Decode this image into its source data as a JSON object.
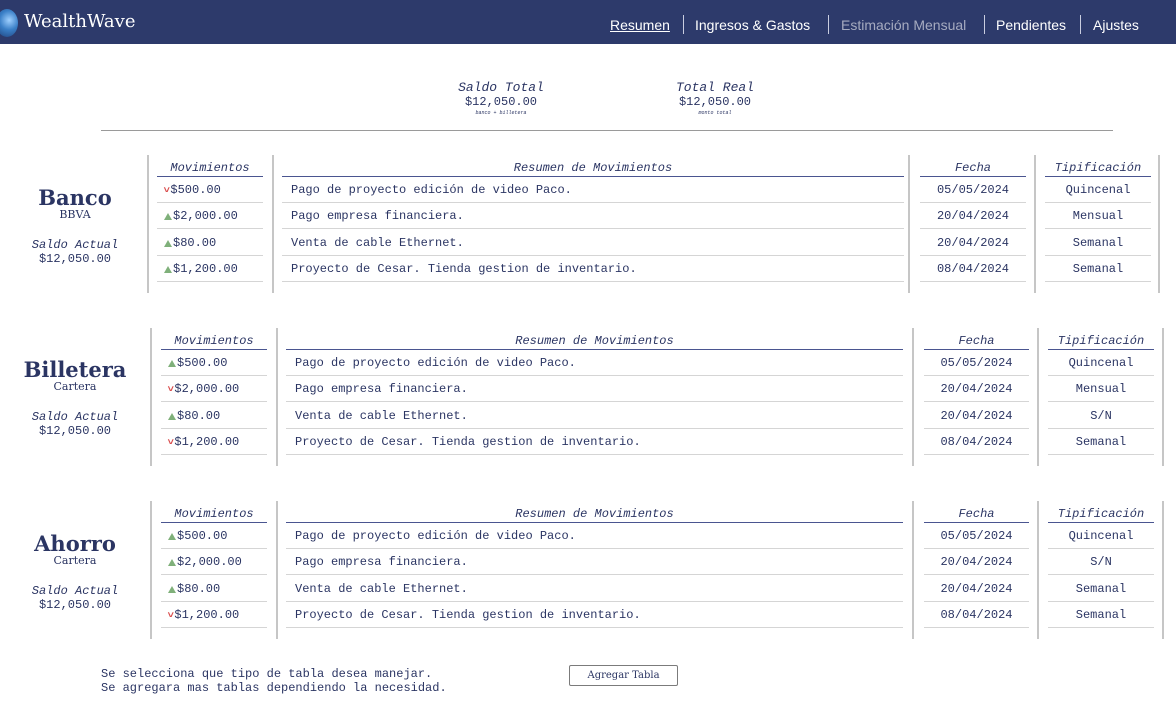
{
  "app": {
    "brand": "WealthWave"
  },
  "nav": {
    "items": [
      {
        "label": "Resumen",
        "state": "active"
      },
      {
        "label": "Ingresos & Gastos",
        "state": "normal"
      },
      {
        "label": "Estimación Mensual",
        "state": "muted"
      },
      {
        "label": "Pendientes",
        "state": "normal"
      },
      {
        "label": "Ajustes",
        "state": "normal"
      }
    ]
  },
  "summary": {
    "saldo_total": {
      "title": "Saldo Total",
      "value": "$12,050.00",
      "note": "banco + billetera"
    },
    "total_real": {
      "title": "Total Real",
      "value": "$12,050.00",
      "note": "monto total"
    }
  },
  "table_headers": {
    "movimientos": "Movimientos",
    "resumen": "Resumen de Movimientos",
    "fecha": "Fecha",
    "tipificacion": "Tipificación"
  },
  "accounts": [
    {
      "name": "Banco",
      "subtitle": "BBVA",
      "saldo_label": "Saldo Actual",
      "saldo_value": "$12,050.00",
      "rows": [
        {
          "dir": "down",
          "amount": "$500.00",
          "desc": "Pago de proyecto edición de video Paco.",
          "date": "05/05/2024",
          "type": "Quincenal"
        },
        {
          "dir": "up",
          "amount": "$2,000.00",
          "desc": "Pago empresa financiera.",
          "date": "20/04/2024",
          "type": "Mensual"
        },
        {
          "dir": "up",
          "amount": "$80.00",
          "desc": "Venta de cable Ethernet.",
          "date": "20/04/2024",
          "type": "Semanal"
        },
        {
          "dir": "up",
          "amount": "$1,200.00",
          "desc": "Proyecto de Cesar. Tienda gestion de inventario.",
          "date": "08/04/2024",
          "type": "Semanal"
        }
      ]
    },
    {
      "name": "Billetera",
      "subtitle": "Cartera",
      "saldo_label": "Saldo Actual",
      "saldo_value": "$12,050.00",
      "rows": [
        {
          "dir": "up",
          "amount": "$500.00",
          "desc": "Pago de proyecto edición de video Paco.",
          "date": "05/05/2024",
          "type": "Quincenal"
        },
        {
          "dir": "down",
          "amount": "$2,000.00",
          "desc": "Pago empresa financiera.",
          "date": "20/04/2024",
          "type": "Mensual"
        },
        {
          "dir": "up",
          "amount": "$80.00",
          "desc": "Venta de cable Ethernet.",
          "date": "20/04/2024",
          "type": "S/N"
        },
        {
          "dir": "down",
          "amount": "$1,200.00",
          "desc": "Proyecto de Cesar. Tienda gestion de inventario.",
          "date": "08/04/2024",
          "type": "Semanal"
        }
      ]
    },
    {
      "name": "Ahorro",
      "subtitle": "Cartera",
      "saldo_label": "Saldo Actual",
      "saldo_value": "$12,050.00",
      "rows": [
        {
          "dir": "up",
          "amount": "$500.00",
          "desc": "Pago de proyecto edición de video Paco.",
          "date": "05/05/2024",
          "type": "Quincenal"
        },
        {
          "dir": "up",
          "amount": "$2,000.00",
          "desc": "Pago empresa financiera.",
          "date": "20/04/2024",
          "type": "S/N"
        },
        {
          "dir": "up",
          "amount": "$80.00",
          "desc": "Venta de cable Ethernet.",
          "date": "20/04/2024",
          "type": "Semanal"
        },
        {
          "dir": "down",
          "amount": "$1,200.00",
          "desc": "Proyecto de Cesar. Tienda gestion de inventario.",
          "date": "08/04/2024",
          "type": "Semanal"
        }
      ]
    }
  ],
  "footer": {
    "line1": "Se selecciona que tipo de tabla desea manejar.",
    "line2": "Se agregara mas tablas dependiendo la necesidad.",
    "button": "Agregar Tabla"
  },
  "colors": {
    "nav_bg": "#2d3a6b",
    "text": "#2b3563",
    "income": "#7fb07a",
    "expense": "#d94b4b"
  }
}
